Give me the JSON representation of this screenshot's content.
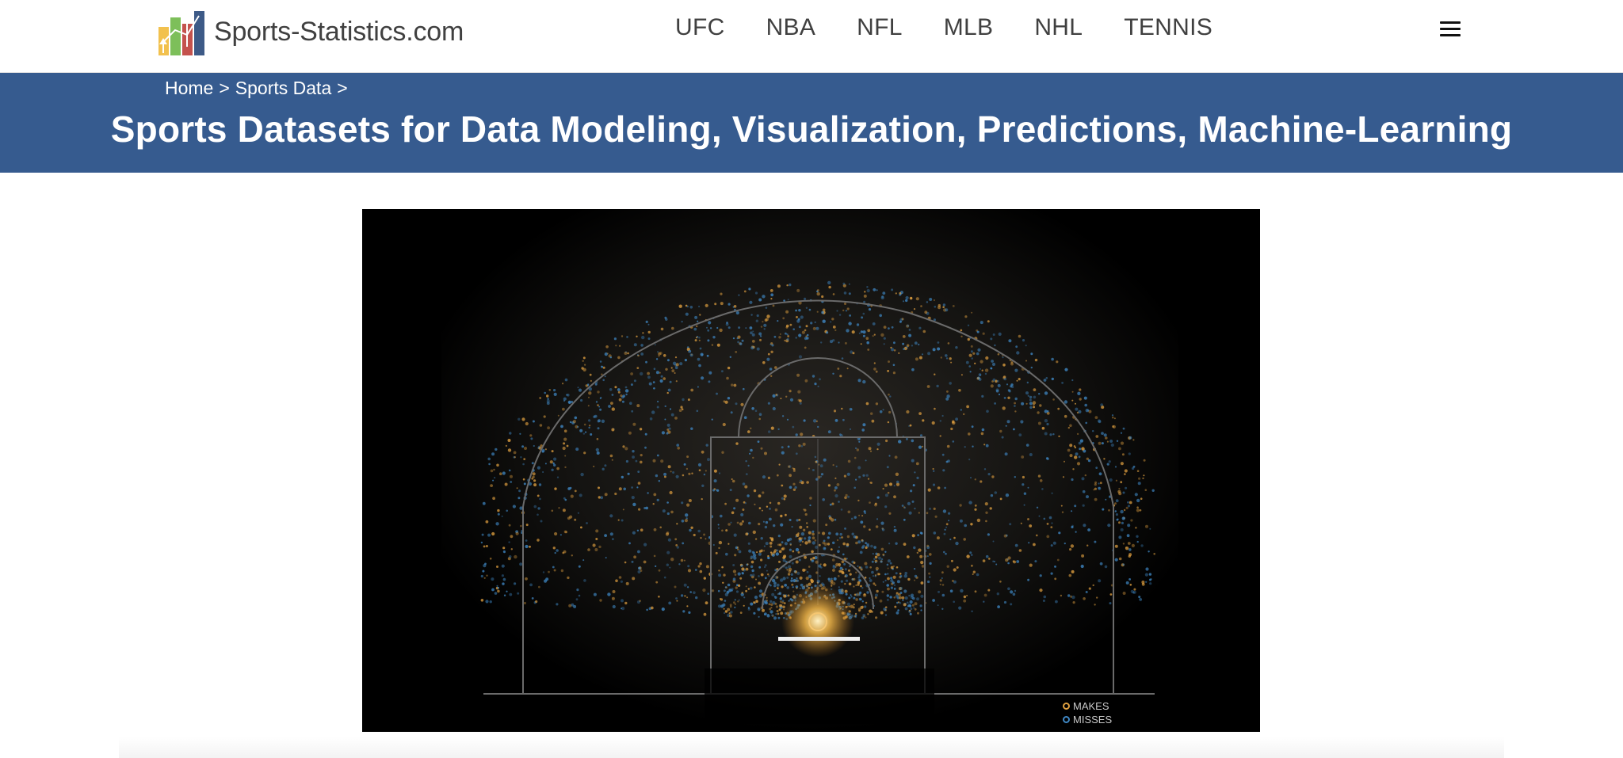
{
  "site": {
    "name": "Sports-Statistics.com",
    "logo_icon": "bar-chart-arrows-icon"
  },
  "nav": {
    "items": [
      "UFC",
      "NBA",
      "NFL",
      "MLB",
      "NHL",
      "TENNIS"
    ],
    "menu_icon": "hamburger-icon"
  },
  "breadcrumb": {
    "home": "Home",
    "sep1": ">",
    "section": "Sports Data",
    "sep2": ">"
  },
  "header": {
    "title": "Sports Datasets for Data Modeling, Visualization, Predictions, Machine-Learning",
    "background": "#365b8f"
  },
  "hero": {
    "legend": {
      "makes": "MAKES",
      "misses": "MISSES"
    },
    "colors": {
      "makes": "#e0a040",
      "misses": "#3f88c5",
      "background": "#000000",
      "court_lines": "#6a6a6a"
    }
  }
}
